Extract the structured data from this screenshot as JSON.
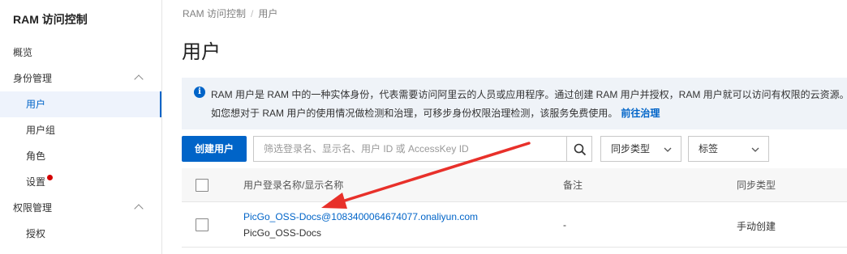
{
  "sidebar": {
    "title": "RAM 访问控制",
    "items": [
      {
        "label": "概览"
      },
      {
        "label": "身份管理"
      },
      {
        "label": "用户"
      },
      {
        "label": "用户组"
      },
      {
        "label": "角色"
      },
      {
        "label": "设置"
      },
      {
        "label": "权限管理"
      },
      {
        "label": "授权"
      }
    ]
  },
  "breadcrumb": {
    "root": "RAM 访问控制",
    "separator": "/",
    "current": "用户"
  },
  "page_title": "用户",
  "notice": {
    "line1": "RAM 用户是 RAM 中的一种实体身份，代表需要访问阿里云的人员或应用程序。通过创建 RAM 用户并授权，RAM 用户就可以访问有权限的云资源。",
    "line2": "如您想对于 RAM 用户的使用情况做检测和治理，可移步身份权限治理检测，该服务免费使用。",
    "link": "前往治理"
  },
  "toolbar": {
    "create_label": "创建用户",
    "search_placeholder": "筛选登录名、显示名、用户 ID 或 AccessKey ID",
    "sync_type_label": "同步类型",
    "tag_label": "标签"
  },
  "table": {
    "headers": {
      "name": "用户登录名称/显示名称",
      "remark": "备注",
      "sync_type": "同步类型"
    },
    "rows": [
      {
        "login_name": "PicGo_OSS-Docs@1083400064674077.onaliyun.com",
        "display_name": "PicGo_OSS-Docs",
        "remark": "-",
        "sync_type": "手动创建"
      }
    ]
  },
  "colors": {
    "accent": "#0064c8",
    "notice_bg": "#eff3f8",
    "annotation_arrow": "#e8302a",
    "badge_dot": "#d40000"
  }
}
